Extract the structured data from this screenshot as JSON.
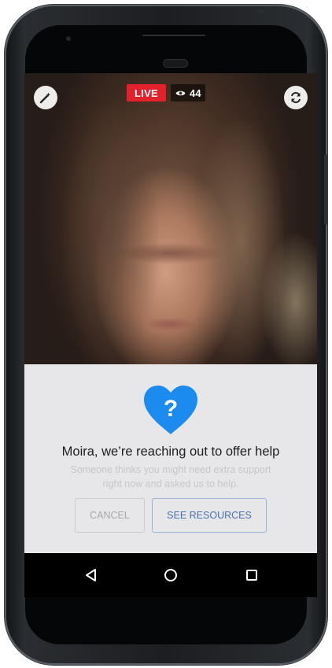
{
  "stream": {
    "live_label": "LIVE",
    "viewer_count": "44"
  },
  "help_prompt": {
    "title": "Moira, we’re reaching out to offer help",
    "subtitle": "Someone thinks you might need extra support right now and asked us to help.",
    "cancel_label": "CANCEL",
    "resources_label": "SEE RESOURCES",
    "heart_symbol": "?"
  },
  "icons": {
    "top_left": "magic-wand-icon",
    "top_right": "camera-flip-icon",
    "viewers": "eye-icon",
    "prompt": "question-heart-icon",
    "nav_back": "back-triangle-icon",
    "nav_home": "home-circle-icon",
    "nav_recent": "recent-apps-square-icon"
  },
  "colors": {
    "live_red": "#e4202d",
    "heart_blue": "#1b8bf0",
    "resources_blue": "#4b72b0",
    "panel_background": "#e7e7e9"
  }
}
